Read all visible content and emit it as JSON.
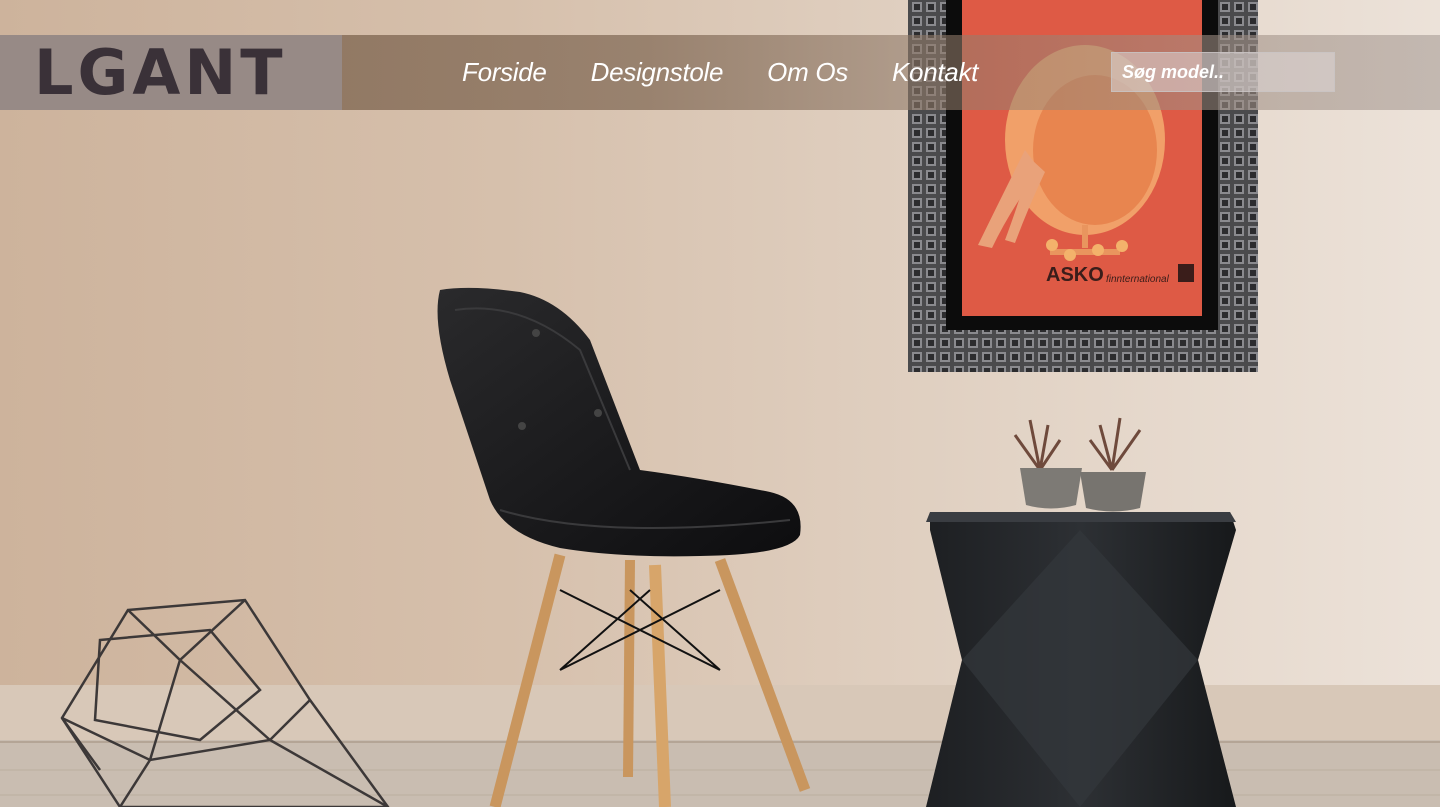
{
  "brand": {
    "logo": "LGANT",
    "colors": {
      "logo_box": "#978a86",
      "logo_text": "#3a3138",
      "nav_text": "#ffffff"
    }
  },
  "nav": {
    "items": [
      {
        "label": "Forside"
      },
      {
        "label": "Designstole"
      },
      {
        "label": "Om Os"
      },
      {
        "label": "Kontakt"
      }
    ]
  },
  "search": {
    "placeholder": "Søg model.."
  },
  "hero": {
    "poster": {
      "brand_text": "ASKO",
      "brand_suffix": "finnternational"
    }
  }
}
